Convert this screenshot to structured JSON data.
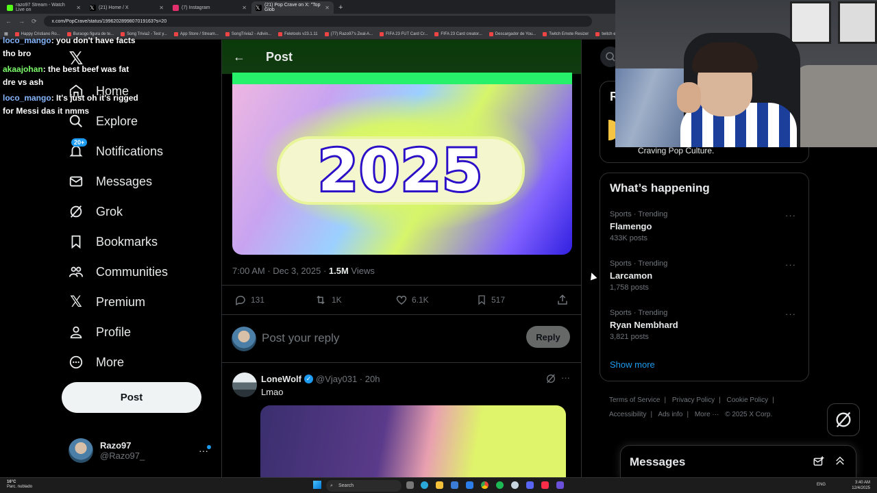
{
  "browser": {
    "tabs": [
      {
        "label": "razo97 Stream - Watch Live on",
        "color": "#53fc18"
      },
      {
        "label": "(21) Home / X",
        "color": "#ffffff"
      },
      {
        "label": "(7) Instagram",
        "color": "#e1306c"
      },
      {
        "label": "(21) Pop Crave on X: \"Top Glob",
        "color": "#ffffff"
      }
    ],
    "new_tab": "+",
    "url": "x.com/PopCrave/status/1996202899807019163?s=20",
    "bookmarks": [
      "Happy Cristiano Ro...",
      "Buraogo figura de te...",
      "Song Trivia2 - Test y...",
      "App Store / Stream...",
      "SongTrivia2 - Adivin...",
      "Feletools v23.1.11",
      "(77) Razo97's Zeal-A...",
      "FIFA 23 FUT Card Cr...",
      "FIFA 23 Card creator...",
      "Descargador de You...",
      "Twitch Emote Resizer",
      "twitch em"
    ]
  },
  "chat": [
    {
      "user": "loco_mango",
      "text": ": you don't have facts tho bro"
    },
    {
      "user": "akaajohan",
      "text": ": the best beef was fat dre vs ash"
    },
    {
      "user": "loco_mango",
      "text": ": It's just oh it's rigged for Messi das it nmms"
    }
  ],
  "nav": {
    "items": [
      "Home",
      "Explore",
      "Notifications",
      "Messages",
      "Grok",
      "Bookmarks",
      "Communities",
      "Premium",
      "Profile",
      "More"
    ],
    "notifications_badge": "20+",
    "post_button": "Post",
    "profile_name": "Razo97",
    "profile_handle": "@Razo97_"
  },
  "post": {
    "header": "Post",
    "media_text": "2025",
    "time": "7:00 AM · Dec 3, 2025 · ",
    "views_count": "1.5M",
    "views_label": " Views",
    "replies": "131",
    "reposts": "1K",
    "likes": "6.1K",
    "bookmarks": "517",
    "reply_placeholder": "Post your reply",
    "reply_button": "Reply"
  },
  "reply": {
    "name": "LoneWolf",
    "handle": "@Vjay031 · 20h",
    "text": "Lmao"
  },
  "sidebar": {
    "relevant_initial": "R",
    "bio": "Craving Pop Culture.",
    "trends_title": "What’s happening",
    "trends": [
      {
        "category": "Sports · Trending",
        "title": "Flamengo",
        "count": "433K posts"
      },
      {
        "category": "Sports · Trending",
        "title": "Larcamon",
        "count": "1,758 posts"
      },
      {
        "category": "Sports · Trending",
        "title": "Ryan Nembhard",
        "count": "3,821 posts"
      }
    ],
    "show_more": "Show more",
    "footer": [
      "Terms of Service",
      "|",
      "Privacy Policy",
      "|",
      "Cookie Policy",
      "|",
      "Accessibility",
      "|",
      "Ads info",
      "|",
      "More ···",
      "© 2025 X Corp."
    ],
    "messages_drawer": "Messages"
  },
  "taskbar": {
    "weather_temp": "16°C",
    "weather_desc": "Parc. nublado",
    "search": "Search",
    "lang": "ENG",
    "time": "3:40 AM",
    "date": "12/4/2025"
  }
}
